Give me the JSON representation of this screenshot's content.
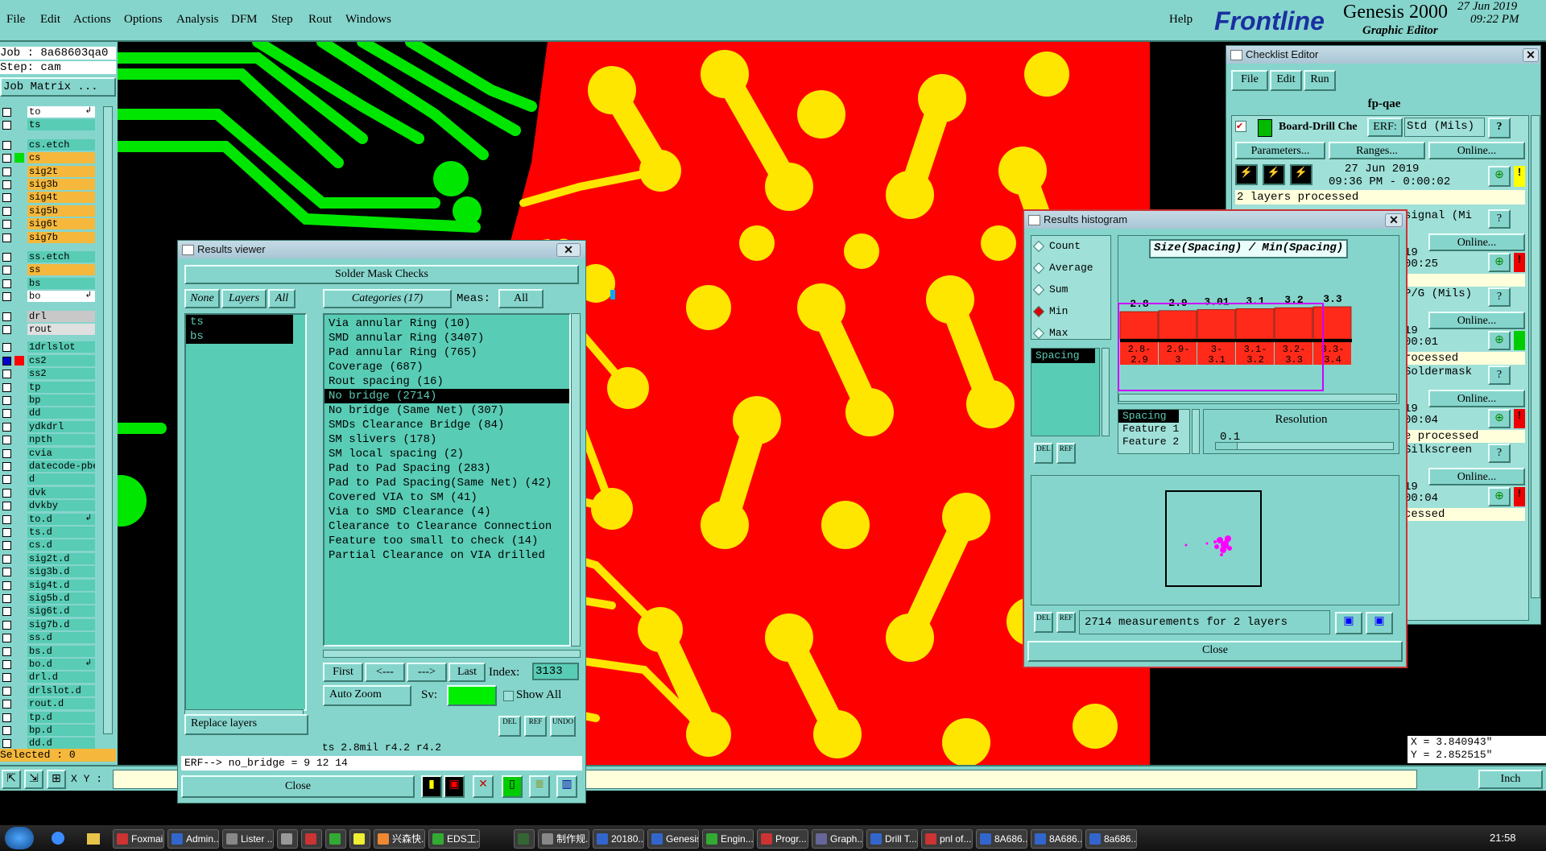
{
  "menubar": {
    "items": [
      "File",
      "Edit",
      "Actions",
      "Options",
      "Analysis",
      "DFM",
      "Step",
      "Rout",
      "Windows"
    ],
    "help": "Help",
    "logo": "Frontline",
    "product": "Genesis 2000",
    "subtitle": "Graphic Editor",
    "date": "27 Jun 2019",
    "time": "09:22 PM"
  },
  "job": {
    "job_label": "Job : 8a68603qa0",
    "step_label": "Step: cam",
    "matrix_button": "Job Matrix ..."
  },
  "layers": [
    {
      "name": "to",
      "color": "#ffffff",
      "marker": "arrow"
    },
    {
      "name": "ts",
      "color": "#59ccb5"
    },
    {
      "name": "cs.etch",
      "color": "#59ccb5"
    },
    {
      "name": "cs",
      "color": "#f5b83c",
      "swatch": "#00dd00"
    },
    {
      "name": "sig2t",
      "color": "#f5b83c"
    },
    {
      "name": "sig3b",
      "color": "#f5b83c"
    },
    {
      "name": "sig4t",
      "color": "#f5b83c"
    },
    {
      "name": "sig5b",
      "color": "#f5b83c"
    },
    {
      "name": "sig6t",
      "color": "#f5b83c"
    },
    {
      "name": "sig7b",
      "color": "#f5b83c"
    },
    {
      "name": "ss.etch",
      "color": "#59ccb5"
    },
    {
      "name": "ss",
      "color": "#f5b83c"
    },
    {
      "name": "bs",
      "color": "#59ccb5"
    },
    {
      "name": "bo",
      "color": "#ffffff",
      "marker": "arrow"
    },
    {
      "name": "drl",
      "color": "#c8c8c8"
    },
    {
      "name": "rout",
      "color": "#e0e0e0"
    },
    {
      "name": "1drlslot",
      "color": "#59ccb5"
    },
    {
      "name": "cs2",
      "color": "#59ccb5",
      "swatch": "#ff0000",
      "checked": true
    },
    {
      "name": "ss2",
      "color": "#59ccb5"
    },
    {
      "name": "tp",
      "color": "#59ccb5"
    },
    {
      "name": "bp",
      "color": "#59ccb5"
    },
    {
      "name": "dd",
      "color": "#59ccb5"
    },
    {
      "name": "ydkdrl",
      "color": "#59ccb5"
    },
    {
      "name": "npth",
      "color": "#59ccb5"
    },
    {
      "name": "cvia",
      "color": "#59ccb5"
    },
    {
      "name": "datecode-pbe",
      "color": "#59ccb5"
    },
    {
      "name": "d",
      "color": "#59ccb5"
    },
    {
      "name": "dvk",
      "color": "#59ccb5"
    },
    {
      "name": "dvkby",
      "color": "#59ccb5"
    },
    {
      "name": "to.d",
      "color": "#59ccb5",
      "marker": "arrow"
    },
    {
      "name": "ts.d",
      "color": "#59ccb5"
    },
    {
      "name": "cs.d",
      "color": "#59ccb5"
    },
    {
      "name": "sig2t.d",
      "color": "#59ccb5"
    },
    {
      "name": "sig3b.d",
      "color": "#59ccb5"
    },
    {
      "name": "sig4t.d",
      "color": "#59ccb5"
    },
    {
      "name": "sig5b.d",
      "color": "#59ccb5"
    },
    {
      "name": "sig6t.d",
      "color": "#59ccb5"
    },
    {
      "name": "sig7b.d",
      "color": "#59ccb5"
    },
    {
      "name": "ss.d",
      "color": "#59ccb5"
    },
    {
      "name": "bs.d",
      "color": "#59ccb5"
    },
    {
      "name": "bo.d",
      "color": "#59ccb5",
      "marker": "arrow"
    },
    {
      "name": "drl.d",
      "color": "#59ccb5"
    },
    {
      "name": "drlslot.d",
      "color": "#59ccb5"
    },
    {
      "name": "rout.d",
      "color": "#59ccb5"
    },
    {
      "name": "tp.d",
      "color": "#59ccb5"
    },
    {
      "name": "bp.d",
      "color": "#59ccb5"
    },
    {
      "name": "dd.d",
      "color": "#59ccb5"
    }
  ],
  "selected_label": "Selected : 0",
  "xy_label": "X Y :",
  "coords": {
    "x": "X = 3.840943\"",
    "y": "Y = 2.852515\""
  },
  "units": "Inch",
  "results_viewer": {
    "title": "Results viewer",
    "header": "Solder Mask Checks",
    "none_btn": "None",
    "layers_btn": "Layers",
    "all_btn": "All",
    "categories_btn": "Categories (17)",
    "meas_label": "Meas:",
    "meas_value": "All",
    "layer_list": [
      "ts",
      "bs"
    ],
    "categories": [
      "Via annular Ring (10)",
      "SMD annular Ring (3407)",
      "Pad annular Ring (765)",
      "Coverage (687)",
      "Rout spacing (16)",
      "No bridge (2714)",
      "No bridge (Same Net) (307)",
      "SMDs Clearance Bridge (84)",
      "SM slivers (178)",
      "SM local spacing (2)",
      "Pad to Pad Spacing (283)",
      "Pad to Pad Spacing(Same Net) (42)",
      "Covered VIA to SM (41)",
      "Via to SMD Clearance (4)",
      "Clearance to Clearance Connection",
      "Feature too small to check (14)",
      "Partial Clearance on VIA drilled"
    ],
    "selected_index": 5,
    "first_btn": "First",
    "prev_btn": "<---",
    "next_btn": "--->",
    "last_btn": "Last",
    "index_label": "Index:",
    "index_value": "3133",
    "zoom_value": "Auto Zoom",
    "sv_label": "Sv:",
    "show_all": "Show All",
    "replace_layers": "Replace layers",
    "info_line": "ts 2.8mil  r4.2  r4.2",
    "erf_line": "ERF--> no_bridge = 9 12 14",
    "close_btn": "Close",
    "del_label": "DEL",
    "ref_label": "REF",
    "undo_label": "UNDO"
  },
  "checklist": {
    "title": "Checklist Editor",
    "menu": [
      "File",
      "Edit",
      "Run"
    ],
    "name": "fp-qae",
    "action_name": "Board-Drill Che",
    "erf_label": "ERF:",
    "erf_value": "Std (Mils)",
    "params_btn": "Parameters...",
    "ranges_btn": "Ranges...",
    "online_btn": "Online...",
    "date": "27 Jun 2019",
    "time": "09:36 PM - 0:00:02",
    "status": "2 layers processed",
    "rows": [
      {
        "erf": "signal (Mi",
        "online": "Online...",
        "t1": "19",
        "t2": "00:25",
        "st": ""
      },
      {
        "erf": "P/G (Mils)",
        "online": "Online...",
        "t1": "19",
        "t2": "00:01",
        "st": "rocessed"
      },
      {
        "erf": "Soldermask",
        "online": "Online...",
        "t1": "19",
        "t2": "00:04",
        "st": "e processed"
      },
      {
        "erf": "Silkscreen",
        "online": "Online...",
        "t1": "19",
        "t2": "00:04",
        "st": "cessed"
      }
    ]
  },
  "histogram": {
    "title": "Results histogram",
    "options": [
      "Count",
      "Average",
      "Sum",
      "Min",
      "Max"
    ],
    "selected_option": 3,
    "heading": "Size(Spacing) / Min(Spacing)",
    "list_item": "Spacing",
    "fields": [
      "Spacing",
      "Feature 1",
      "Feature 2"
    ],
    "resolution_label": "Resolution",
    "resolution_value": "0.1",
    "footer": "2714 measurements for 2 layers",
    "close_btn": "Close",
    "del_label": "DEL",
    "ref_label": "REF"
  },
  "chart_data": {
    "type": "bar",
    "categories": [
      "2.8-2.9",
      "2.9-3",
      "3-3.1",
      "3.1-3.2",
      "3.2-3.3",
      "3.3-3.4"
    ],
    "top_labels": [
      "2.8",
      "2.9",
      "3.01",
      "3.1",
      "3.2",
      "3.3"
    ],
    "bin_labels_top": [
      "2.8-",
      "2.9-",
      "3-",
      "3.1-",
      "3.2-",
      "3.3-"
    ],
    "bin_labels_bottom": [
      "2.9",
      "3",
      "3.1",
      "3.2",
      "3.3",
      "3.4"
    ],
    "values": [
      2.8,
      2.9,
      3.01,
      3.1,
      3.2,
      3.3
    ],
    "ylim": [
      0,
      3.3
    ],
    "colors": {
      "bar": "#ff2a1a"
    }
  },
  "taskbar": {
    "buttons": [
      "Foxmail",
      "Admin...",
      "Lister ...",
      "",
      "",
      "",
      "",
      "兴森快...",
      "EDS工...",
      "",
      "制作规...",
      "20180...",
      "Genesis",
      "Engin...",
      "Progr...",
      "Graph...",
      "Drill T...",
      "pnl of...",
      "8A686...",
      "8A686...",
      "8a686..."
    ],
    "clock": "21:58"
  }
}
